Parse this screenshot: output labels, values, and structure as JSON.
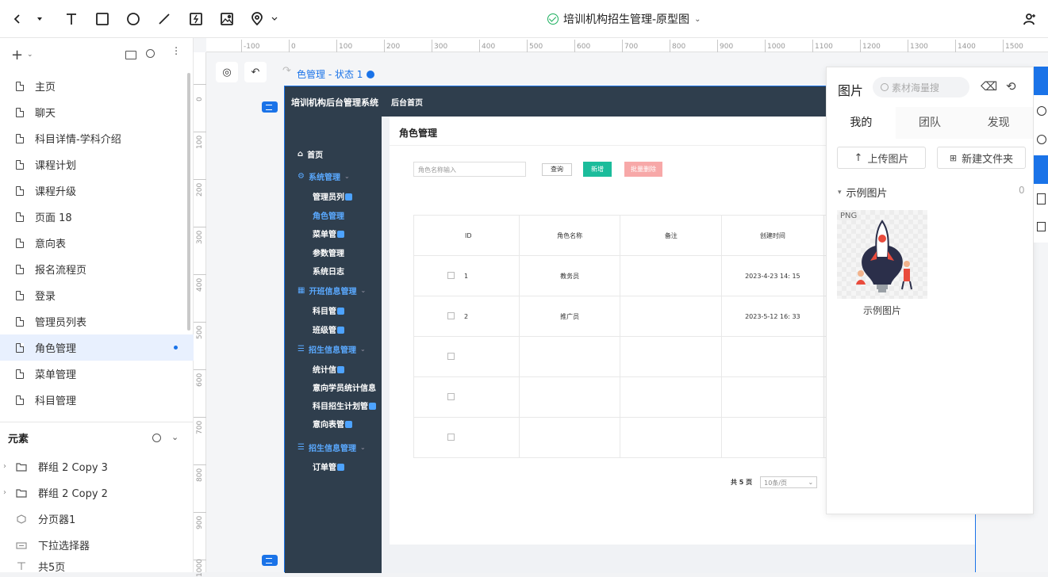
{
  "doc_title": "培训机构招生管理-原型图",
  "pages": [
    {
      "label": "主页"
    },
    {
      "label": "聊天"
    },
    {
      "label": "科目详情-学科介绍"
    },
    {
      "label": "课程计划"
    },
    {
      "label": "课程升级"
    },
    {
      "label": "页面 18"
    },
    {
      "label": "意向表"
    },
    {
      "label": "报名流程页"
    },
    {
      "label": "登录"
    },
    {
      "label": "管理员列表"
    },
    {
      "label": "角色管理"
    },
    {
      "label": "菜单管理"
    },
    {
      "label": "科目管理"
    }
  ],
  "elements_panel": {
    "title": "元素",
    "items": [
      {
        "label": "群组 2 Copy 3"
      },
      {
        "label": "群组 2 Copy 2"
      },
      {
        "label": "分页器1"
      },
      {
        "label": "下拉选择器"
      },
      {
        "label": "共5页"
      }
    ]
  },
  "ruler": {
    "top": [
      "-100",
      "0",
      "100",
      "200",
      "300",
      "400",
      "500",
      "600",
      "700",
      "800",
      "900",
      "1000",
      "1100",
      "1200",
      "1300",
      "1400",
      "1500"
    ],
    "left": [
      "0",
      "100",
      "200",
      "300",
      "400",
      "500",
      "600",
      "700",
      "800",
      "900",
      "1000"
    ]
  },
  "state_label": "色管理 - 状态 1",
  "artboard": {
    "brand": "培训机构后台管理系统",
    "nav_home": "后台首页",
    "menu": {
      "home": "首页",
      "system": "系统管理",
      "admin_list": "管理员列",
      "role_mgmt": "角色管理",
      "menu_mgmt": "菜单管",
      "param_mgmt": "参数管理",
      "sys_log": "系统日志",
      "class_info": "开班信息管理",
      "subject": "科目管",
      "class": "班级管",
      "enroll_info": "招生信息管理",
      "stats": "统计信",
      "intent_stats": "意向学员统计信息",
      "subject_plan": "科目招生计划管",
      "intent_table": "意向表管",
      "enroll_info2": "招生信息管理",
      "orders": "订单管"
    },
    "page_title": "角色管理",
    "search_placeholder": "角色名称输入",
    "btn_query": "查询",
    "btn_add": "新增",
    "btn_batch_delete": "批量删除",
    "table": {
      "headers": [
        "ID",
        "角色名称",
        "备注",
        "创建时间"
      ],
      "rows": [
        {
          "id": "1",
          "name": "教务员",
          "note": "",
          "created": "2023-4-23  14: 15"
        },
        {
          "id": "2",
          "name": "推广员",
          "note": "",
          "created": "2023-5-12  16: 33"
        }
      ]
    },
    "pager_total": "共 5 页",
    "pager_size": "10条/页"
  },
  "image_panel": {
    "title": "图片",
    "search_placeholder": "素材海量搜",
    "tabs": [
      "我的",
      "团队",
      "发现"
    ],
    "upload_label": "上传图片",
    "new_folder_label": "新建文件夹",
    "folder_label": "示例图片",
    "folder_count": "0",
    "thumb_type": "PNG",
    "thumb_caption": "示例图片"
  },
  "colors": {
    "accent": "#1a73e8",
    "sidebar_dark": "#2f3e4d",
    "add_button": "#1bbc9b",
    "delete_button": "#f7a8a8",
    "saved_check": "#1aaf5d"
  }
}
